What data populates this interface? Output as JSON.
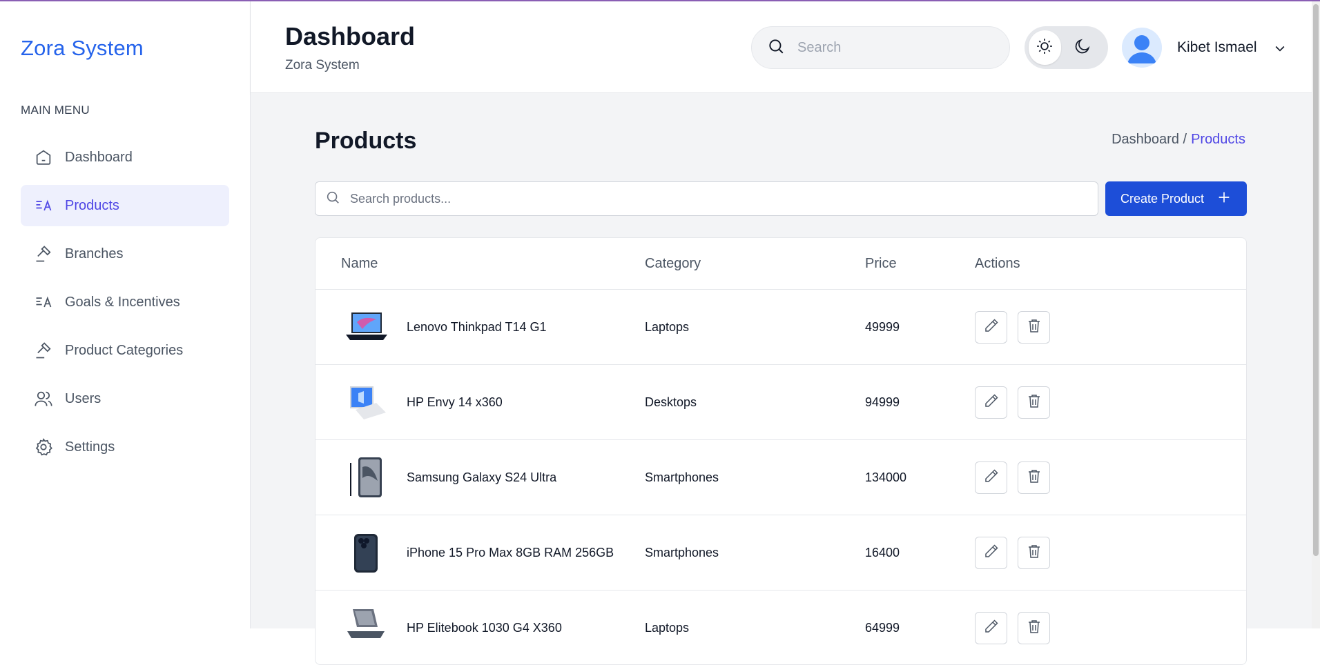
{
  "brand": {
    "name": "Zora System"
  },
  "sidebar": {
    "heading": "MAIN MENU",
    "items": [
      {
        "label": "Dashboard",
        "icon": "home-icon"
      },
      {
        "label": "Products",
        "icon": "translate-icon",
        "active": true
      },
      {
        "label": "Branches",
        "icon": "gavel-icon"
      },
      {
        "label": "Goals & Incentives",
        "icon": "translate-icon"
      },
      {
        "label": "Product Categories",
        "icon": "gavel-icon"
      },
      {
        "label": "Users",
        "icon": "users-icon"
      },
      {
        "label": "Settings",
        "icon": "gear-icon"
      }
    ]
  },
  "header": {
    "title": "Dashboard",
    "subtitle": "Zora System",
    "search_placeholder": "Search",
    "user_name": "Kibet Ismael"
  },
  "page": {
    "title": "Products",
    "breadcrumb": {
      "parent": "Dashboard /",
      "current": "Products"
    },
    "search_placeholder": "Search products...",
    "create_label": "Create Product"
  },
  "table": {
    "columns": [
      "Name",
      "Category",
      "Price",
      "Actions"
    ],
    "rows": [
      {
        "name": "Lenovo Thinkpad T14 G1",
        "category": "Laptops",
        "price": "49999",
        "thumb": "laptop-image"
      },
      {
        "name": "HP Envy 14 x360",
        "category": "Desktops",
        "price": "94999",
        "thumb": "laptop-image"
      },
      {
        "name": "Samsung Galaxy S24 Ultra",
        "category": "Smartphones",
        "price": "134000",
        "thumb": "phone-image"
      },
      {
        "name": "iPhone 15 Pro Max 8GB RAM 256GB",
        "category": "Smartphones",
        "price": "16400",
        "thumb": "phone-image"
      },
      {
        "name": "HP Elitebook 1030 G4 X360",
        "category": "Laptops",
        "price": "64999",
        "thumb": "laptop-image"
      }
    ]
  },
  "colors": {
    "accent": "#2563eb",
    "active_bg": "#eef0fd",
    "active_text": "#4f46e5",
    "button": "#1d4ed8",
    "page_bg": "#f3f4f6"
  }
}
